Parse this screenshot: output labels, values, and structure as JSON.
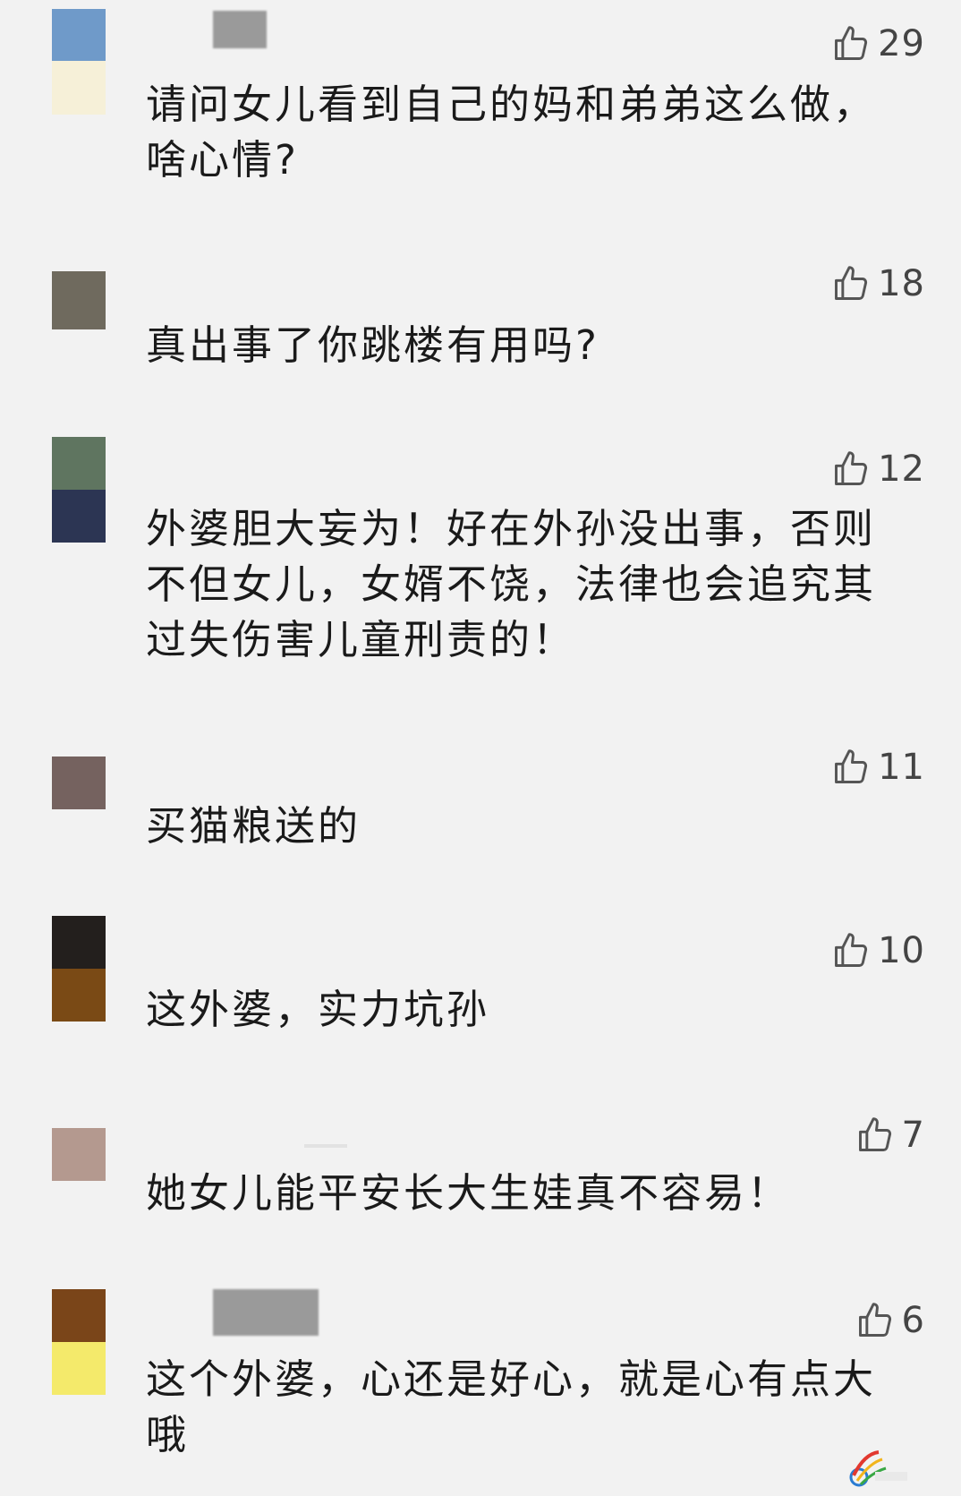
{
  "comments": [
    {
      "likes": "29",
      "text": "请问女儿看到自己的妈和弟弟这么做，\n啥心情?"
    },
    {
      "likes": "18",
      "text": "真出事了你跳楼有用吗?"
    },
    {
      "likes": "12",
      "text": "外婆胆大妄为！好在外孙没出事，否则\n不但女儿，女婿不饶，法律也会追究其\n过失伤害儿童刑责的！"
    },
    {
      "likes": "11",
      "text": "买猫粮送的"
    },
    {
      "likes": "10",
      "text": "这外婆，实力坑孙"
    },
    {
      "likes": "7",
      "text": "她女儿能平安长大生娃真不容易！"
    },
    {
      "likes": "6",
      "text": "这个外婆，心还是好心，就是心有点大\n哦"
    }
  ],
  "icons": {
    "like": "thumbs-up-outline-icon"
  },
  "colors": {
    "background": "#f2f2f2",
    "text": "#1a1a1a",
    "like": "#444444"
  }
}
